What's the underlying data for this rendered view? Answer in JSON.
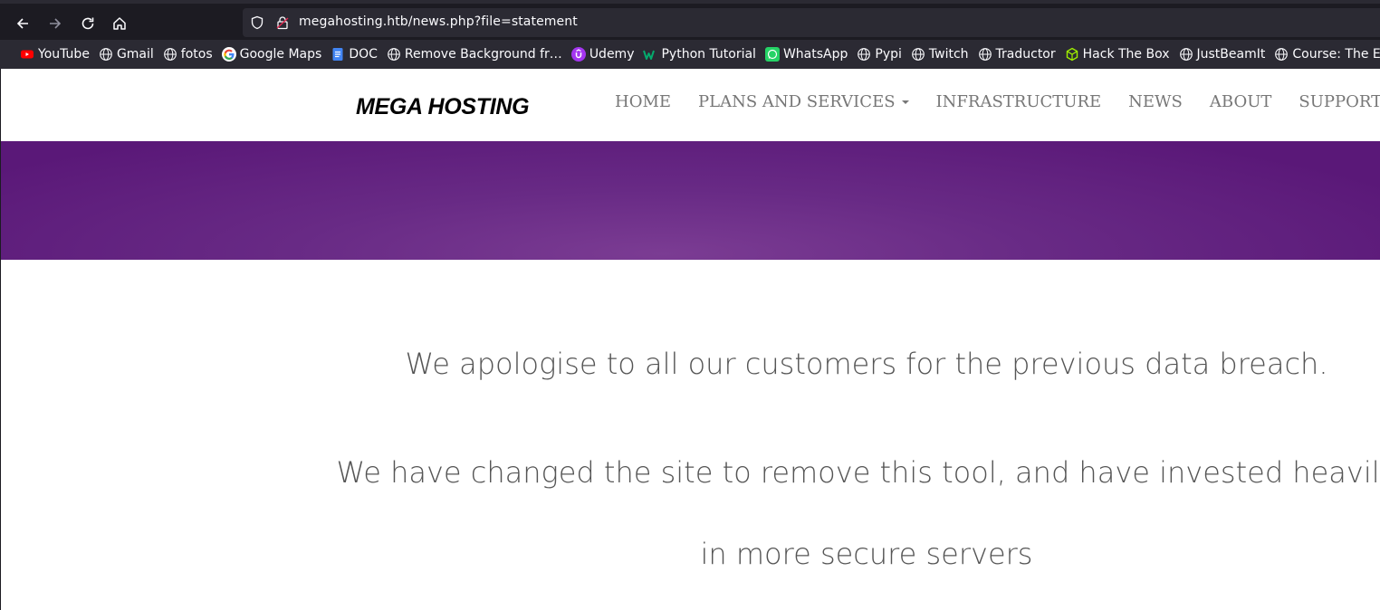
{
  "browser": {
    "url": "megahosting.htb/news.php?file=statement",
    "bookmarks": [
      {
        "label": "YouTube",
        "icon": "youtube-icon"
      },
      {
        "label": "Gmail",
        "icon": "globe-icon"
      },
      {
        "label": "fotos",
        "icon": "globe-icon"
      },
      {
        "label": "Google Maps",
        "icon": "google-icon"
      },
      {
        "label": "DOC",
        "icon": "docs-icon"
      },
      {
        "label": "Remove Background fr…",
        "icon": "globe-icon"
      },
      {
        "label": "Udemy",
        "icon": "udemy-icon"
      },
      {
        "label": "Python Tutorial",
        "icon": "w3-icon"
      },
      {
        "label": "WhatsApp",
        "icon": "whatsapp-icon"
      },
      {
        "label": "Pypi",
        "icon": "globe-icon"
      },
      {
        "label": "Twitch",
        "icon": "globe-icon"
      },
      {
        "label": "Traductor",
        "icon": "globe-icon"
      },
      {
        "label": "Hack The Box",
        "icon": "htb-icon"
      },
      {
        "label": "JustBeamIt",
        "icon": "globe-icon"
      },
      {
        "label": "Course: The Evo",
        "icon": "globe-icon"
      }
    ]
  },
  "site": {
    "logo": "MEGA HOSTING",
    "nav": [
      {
        "label": "HOME"
      },
      {
        "label": "PLANS AND SERVICES"
      },
      {
        "label": "INFRASTRUCTURE"
      },
      {
        "label": "NEWS"
      },
      {
        "label": "ABOUT"
      },
      {
        "label": "SUPPORT"
      }
    ],
    "banner_color": "#682a85"
  },
  "statement": {
    "line1": "We apologise to all our customers for the previous data breach.",
    "line2": "We have changed the site to remove this tool, and have invested heavily",
    "line3": "in more secure servers"
  }
}
